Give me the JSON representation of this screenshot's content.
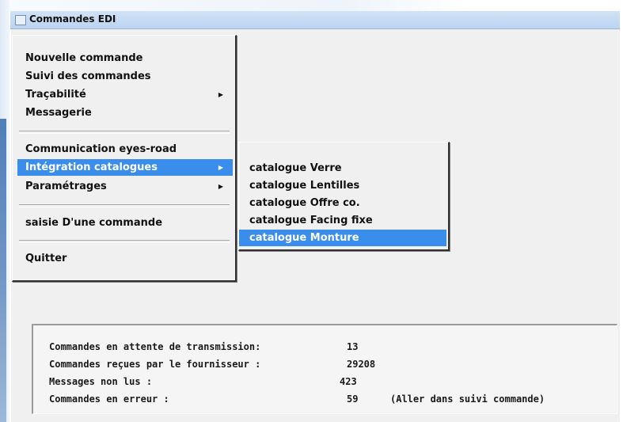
{
  "window": {
    "title": "Commandes EDI"
  },
  "main_menu": {
    "items": [
      {
        "label": "Nouvelle commande"
      },
      {
        "label": "Suivi des commandes"
      },
      {
        "label": "Traçabilité",
        "submenu_arrow": "▶"
      },
      {
        "label": "Messagerie"
      },
      {
        "label": "Communication eyes-road"
      },
      {
        "label": "Intégration catalogues",
        "submenu_arrow": "▶",
        "selected": true
      },
      {
        "label": "Paramétrages",
        "submenu_arrow": "▶"
      },
      {
        "label": "saisie D'une commande"
      },
      {
        "label": "Quitter"
      }
    ]
  },
  "catalog_submenu": {
    "items": [
      {
        "label": "catalogue Verre"
      },
      {
        "label": "catalogue Lentilles"
      },
      {
        "label": "catalogue Offre co."
      },
      {
        "label": "catalogue Facing fixe"
      },
      {
        "label": "catalogue Monture",
        "selected": true
      }
    ]
  },
  "status": {
    "rows": [
      {
        "label": "Commandes en attente de transmission:",
        "value": "13",
        "note": ""
      },
      {
        "label": "Commandes reçues par le fournisseur :",
        "value": "29208",
        "note": ""
      },
      {
        "label": "Messages non lus :",
        "value": "423",
        "note": ""
      },
      {
        "label": "Commandes en erreur :",
        "value": "59",
        "note": "(Aller dans suivi commande)"
      }
    ]
  },
  "colors": {
    "selection": "#3a8dea",
    "window_bg": "#f0f0f0",
    "titlebar": "#c8dcf4"
  }
}
